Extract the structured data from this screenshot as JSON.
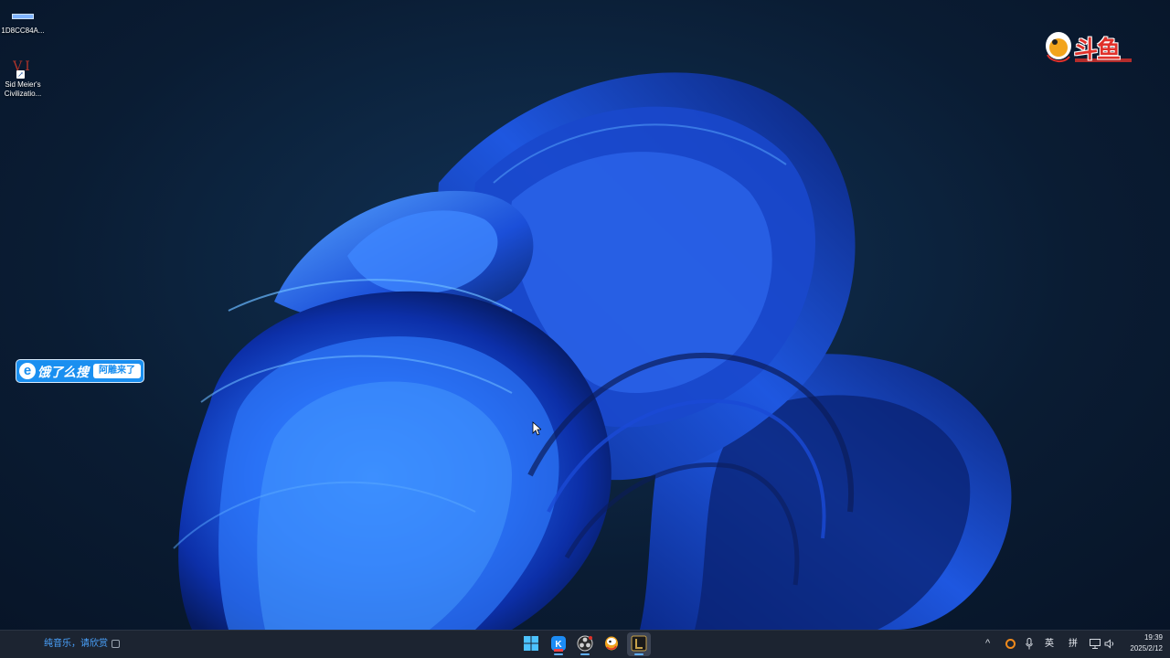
{
  "desktop": {
    "icons": [
      {
        "label": "1D8CC84A...",
        "icon": "file-icon"
      },
      {
        "label": "Sid Meier's\nCivilizatio...",
        "glyph_text": "VI",
        "icon": "civilization-vi-icon"
      }
    ],
    "overlays": {
      "douyu_logo_text": "斗鱼",
      "eleme_banner": {
        "e_letter": "e",
        "title": "饿了么搜",
        "tag": "阿雕来了"
      }
    }
  },
  "taskbar": {
    "widget_text": "纯音乐，请欣赏",
    "pinned_apps": [
      {
        "name": "Start",
        "icon": "windows-start-icon",
        "active": false
      },
      {
        "name": "KuGou Music",
        "icon": "kugou-icon",
        "active": true
      },
      {
        "name": "OBS Studio",
        "icon": "obs-icon",
        "active": true
      },
      {
        "name": "Douyu",
        "icon": "douyu-icon",
        "active": false
      },
      {
        "name": "League of Legends",
        "icon": "league-of-legends-icon",
        "active": true
      }
    ],
    "tray": {
      "chevron": "^",
      "language": "英",
      "ime_mode": "拼",
      "time": "19:39",
      "date": "2025/2/12"
    }
  },
  "colors": {
    "accent": "#4aa3ff",
    "taskbar_bg": "#1c2431",
    "eleme_blue": "#1a8ff0",
    "douyu_red": "#e0312a"
  }
}
